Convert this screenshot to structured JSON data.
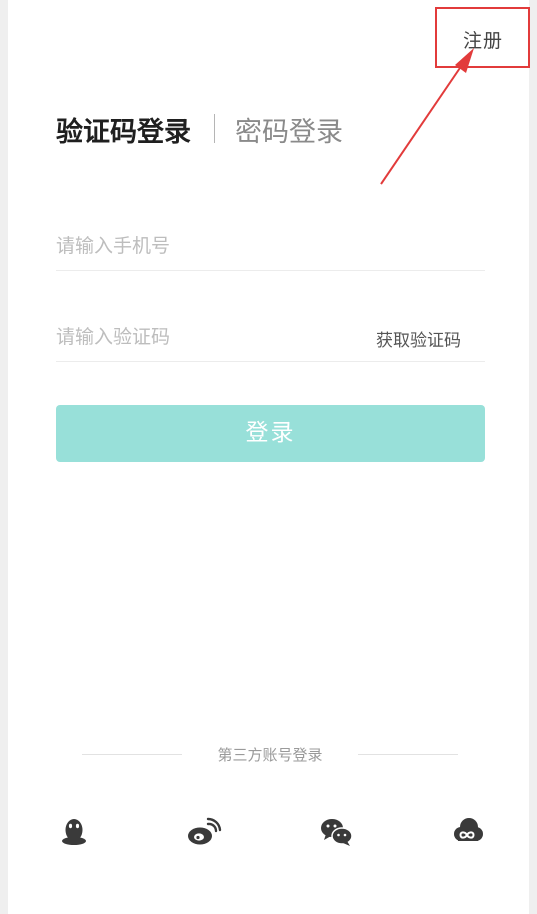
{
  "header": {
    "register_label": "注册"
  },
  "tabs": {
    "active_label": "验证码登录",
    "inactive_label": "密码登录"
  },
  "phone_field": {
    "placeholder": "请输入手机号",
    "value": ""
  },
  "code_field": {
    "placeholder": "请输入验证码",
    "value": "",
    "get_code_label": "获取验证码"
  },
  "login_button": {
    "label": "登录"
  },
  "third_party": {
    "divider_text": "第三方账号登录"
  },
  "social_icons": [
    "qq-icon",
    "weibo-icon",
    "wechat-icon",
    "cloud-icon"
  ],
  "colors": {
    "accent": "#98e0d9",
    "annotation": "#e23b3b",
    "text_primary": "#1f1f1f",
    "text_muted": "#8a8a8a",
    "icon": "#3a3a3a"
  }
}
